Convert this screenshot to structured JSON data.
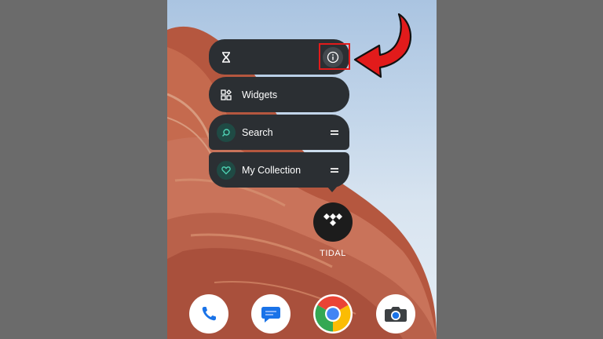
{
  "popup_menu": {
    "top_row": {
      "left_icon": "hourglass-icon",
      "right_icon": "info-icon"
    },
    "items": [
      {
        "label": "Widgets",
        "icon": "widgets-grid-icon"
      },
      {
        "label": "Search",
        "icon": "search-icon",
        "accent": "#1f4a44"
      },
      {
        "label": "My Collection",
        "icon": "heart-icon",
        "accent": "#1f4a44"
      }
    ]
  },
  "app": {
    "label": "TIDAL",
    "icon": "tidal-logo-icon"
  },
  "dock": [
    {
      "icon": "phone-icon"
    },
    {
      "icon": "messages-icon"
    },
    {
      "icon": "chrome-icon"
    },
    {
      "icon": "camera-icon"
    }
  ],
  "annotation": {
    "highlight_color": "#e21b1b",
    "arrow_icon": "red-curved-arrow-icon"
  },
  "colors": {
    "menu_background": "#2b2f33",
    "outer_background": "#6b6b6b",
    "shortcut_accent": "#1f4a44"
  }
}
